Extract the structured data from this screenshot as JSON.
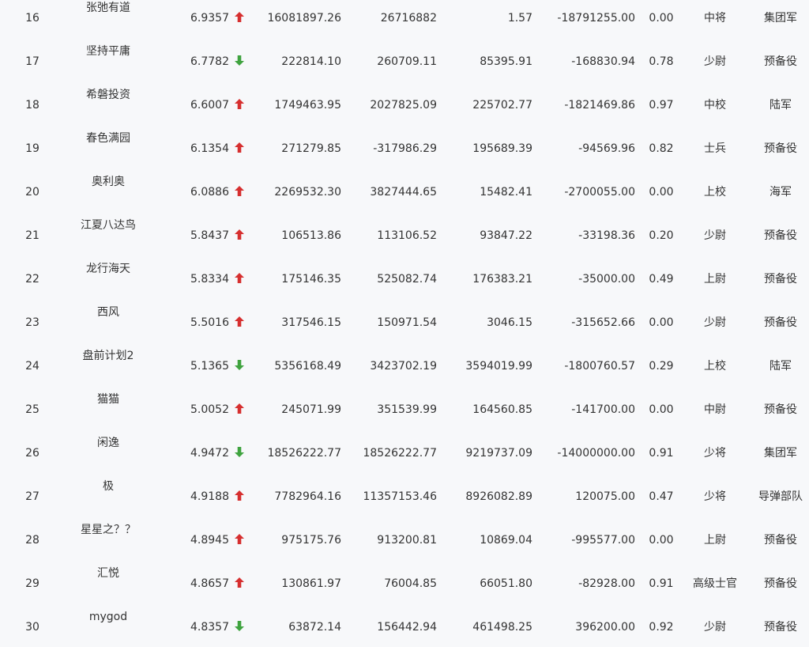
{
  "colors": {
    "up": "#d62f2f",
    "down": "#3fa33f",
    "text": "#333333",
    "background": "#f7f8fa"
  },
  "rows": [
    {
      "rank": "16",
      "name": "张弛有道",
      "score": "6.9357",
      "trend": "up",
      "c1": "16081897.26",
      "c2": "26716882",
      "c3": "1.57",
      "c4": "-18791255.00",
      "ratio": "0.00",
      "rank_title": "中将",
      "branch": "集团军"
    },
    {
      "rank": "17",
      "name": "坚持平庸",
      "score": "6.7782",
      "trend": "down",
      "c1": "222814.10",
      "c2": "260709.11",
      "c3": "85395.91",
      "c4": "-168830.94",
      "ratio": "0.78",
      "rank_title": "少尉",
      "branch": "预备役"
    },
    {
      "rank": "18",
      "name": "希磐投资",
      "score": "6.6007",
      "trend": "up",
      "c1": "1749463.95",
      "c2": "2027825.09",
      "c3": "225702.77",
      "c4": "-1821469.86",
      "ratio": "0.97",
      "rank_title": "中校",
      "branch": "陆军"
    },
    {
      "rank": "19",
      "name": "春色满园",
      "score": "6.1354",
      "trend": "up",
      "c1": "271279.85",
      "c2": "-317986.29",
      "c3": "195689.39",
      "c4": "-94569.96",
      "ratio": "0.82",
      "rank_title": "士兵",
      "branch": "预备役"
    },
    {
      "rank": "20",
      "name": "奥利奥",
      "score": "6.0886",
      "trend": "up",
      "c1": "2269532.30",
      "c2": "3827444.65",
      "c3": "15482.41",
      "c4": "-2700055.00",
      "ratio": "0.00",
      "rank_title": "上校",
      "branch": "海军"
    },
    {
      "rank": "21",
      "name": "江夏八达鸟",
      "score": "5.8437",
      "trend": "up",
      "c1": "106513.86",
      "c2": "113106.52",
      "c3": "93847.22",
      "c4": "-33198.36",
      "ratio": "0.20",
      "rank_title": "少尉",
      "branch": "预备役"
    },
    {
      "rank": "22",
      "name": "龙行海天",
      "score": "5.8334",
      "trend": "up",
      "c1": "175146.35",
      "c2": "525082.74",
      "c3": "176383.21",
      "c4": "-35000.00",
      "ratio": "0.49",
      "rank_title": "上尉",
      "branch": "预备役"
    },
    {
      "rank": "23",
      "name": "西风",
      "score": "5.5016",
      "trend": "up",
      "c1": "317546.15",
      "c2": "150971.54",
      "c3": "3046.15",
      "c4": "-315652.66",
      "ratio": "0.00",
      "rank_title": "少尉",
      "branch": "预备役"
    },
    {
      "rank": "24",
      "name": "盘前计划2",
      "score": "5.1365",
      "trend": "down",
      "c1": "5356168.49",
      "c2": "3423702.19",
      "c3": "3594019.99",
      "c4": "-1800760.57",
      "ratio": "0.29",
      "rank_title": "上校",
      "branch": "陆军"
    },
    {
      "rank": "25",
      "name": "猫猫",
      "score": "5.0052",
      "trend": "up",
      "c1": "245071.99",
      "c2": "351539.99",
      "c3": "164560.85",
      "c4": "-141700.00",
      "ratio": "0.00",
      "rank_title": "中尉",
      "branch": "预备役"
    },
    {
      "rank": "26",
      "name": "闲逸",
      "score": "4.9472",
      "trend": "down",
      "c1": "18526222.77",
      "c2": "18526222.77",
      "c3": "9219737.09",
      "c4": "-14000000.00",
      "ratio": "0.91",
      "rank_title": "少将",
      "branch": "集团军"
    },
    {
      "rank": "27",
      "name": "极",
      "score": "4.9188",
      "trend": "up",
      "c1": "7782964.16",
      "c2": "11357153.46",
      "c3": "8926082.89",
      "c4": "120075.00",
      "ratio": "0.47",
      "rank_title": "少将",
      "branch": "导弹部队"
    },
    {
      "rank": "28",
      "name": "星星之？？",
      "score": "4.8945",
      "trend": "up",
      "c1": "975175.76",
      "c2": "913200.81",
      "c3": "10869.04",
      "c4": "-995577.00",
      "ratio": "0.00",
      "rank_title": "上尉",
      "branch": "预备役"
    },
    {
      "rank": "29",
      "name": "汇悦",
      "score": "4.8657",
      "trend": "up",
      "c1": "130861.97",
      "c2": "76004.85",
      "c3": "66051.80",
      "c4": "-82928.00",
      "ratio": "0.91",
      "rank_title": "高级士官",
      "branch": "预备役"
    },
    {
      "rank": "30",
      "name": "mygod",
      "score": "4.8357",
      "trend": "down",
      "c1": "63872.14",
      "c2": "156442.94",
      "c3": "461498.25",
      "c4": "396200.00",
      "ratio": "0.92",
      "rank_title": "少尉",
      "branch": "预备役"
    }
  ]
}
